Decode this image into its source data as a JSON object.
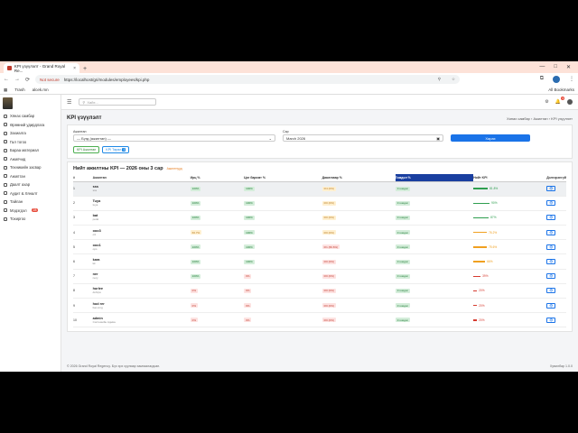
{
  "browser": {
    "tab_title": "KPI үзүүлэлт - Grand Royal Re...",
    "not_secure": "Not secure",
    "url": "https://localhost/gri/modules/employees/kpi.php",
    "bookmarks": [
      "Trash",
      "alcek.mn"
    ],
    "all_bookmarks": "All Bookmarks"
  },
  "sidebar": {
    "items": [
      {
        "label": "Хянах самбар"
      },
      {
        "label": "Өрөөний удирдлага"
      },
      {
        "label": "Захиалга"
      },
      {
        "label": "Гал тогоо"
      },
      {
        "label": "Бараа материал"
      },
      {
        "label": "Ажилчид"
      },
      {
        "label": "Техникийн засвар"
      },
      {
        "label": "Ажилтан"
      },
      {
        "label": "Даалт ахар"
      },
      {
        "label": "Аудит & Хяналт"
      },
      {
        "label": "Тайлан"
      },
      {
        "label": "Мэдэгдэл",
        "badge": "28"
      },
      {
        "label": "Тохиргоо"
      }
    ]
  },
  "topbar": {
    "search_placeholder": "Хайх...",
    "notif_count": "3"
  },
  "page": {
    "title": "KPI үзүүлэлт",
    "breadcrumb": "Хянах самбар › Ажилтан › KPI үзүүлэлт"
  },
  "filters": {
    "employee_label": "Ажилтан",
    "employee_value": "— Бүгд (ажилтан) —",
    "month_label": "Сар",
    "month_value": "March 2026",
    "submit_label": "Харах",
    "chip_summary": "KPI Ажилтан",
    "chip_type": "KPI Төрөл",
    "chip_type_count": "1"
  },
  "table": {
    "title": "Нийт ажилтны KPI — 2026 оны 3 сар",
    "subtitle": "Ажилтнууд",
    "columns": [
      "#",
      "Ажилтан",
      "Ирц %",
      "Цаг баримт %",
      "Даалгавар %",
      "Гомдол %",
      "Нийт KPI",
      "Дэлгэрэнгүй"
    ],
    "rows": [
      {
        "n": "1",
        "name": "sss",
        "login": "sss",
        "attendance": "100%",
        "att_c": "g",
        "hours": "100%",
        "hrs_c": "g",
        "tasks": "0/4 (0%)",
        "tsk_c": "o",
        "complaint": "0 гомдол",
        "kpi": "81.8%",
        "kpi_c": "g",
        "kpi_frac": 0.818
      },
      {
        "n": "2",
        "name": "Tuya",
        "login": "tuya",
        "attendance": "100%",
        "att_c": "g",
        "hours": "100%",
        "hrs_c": "g",
        "tasks": "0/0 (0%)",
        "tsk_c": "o",
        "complaint": "0 гомдол",
        "kpi": "90%",
        "kpi_c": "g",
        "kpi_frac": 0.9
      },
      {
        "n": "3",
        "name": "bat",
        "login": "petal",
        "attendance": "100%",
        "att_c": "g",
        "hours": "100%",
        "hrs_c": "g",
        "tasks": "0/0 (0%)",
        "tsk_c": "o",
        "complaint": "0 гомдол",
        "kpi": "87%",
        "kpi_c": "g",
        "kpi_frac": 0.87
      },
      {
        "n": "4",
        "name": "ooo3",
        "login": "o3",
        "attendance": "66.7%",
        "att_c": "o",
        "hours": "100%",
        "hrs_c": "g",
        "tasks": "0/0 (0%)",
        "tsk_c": "o",
        "complaint": "0 гомдол",
        "kpi": "76.2%",
        "kpi_c": "o",
        "kpi_frac": 0.762
      },
      {
        "n": "5",
        "name": "ooo1",
        "login": "ops",
        "attendance": "100%",
        "att_c": "g",
        "hours": "100%",
        "hrs_c": "g",
        "tasks": "0/1 (66.6%)",
        "tsk_c": "r",
        "complaint": "0 гомдол",
        "kpi": "75.6%",
        "kpi_c": "o",
        "kpi_frac": 0.756
      },
      {
        "n": "6",
        "name": "kara",
        "login": "kk",
        "attendance": "100%",
        "att_c": "g",
        "hours": "100%",
        "hrs_c": "g",
        "tasks": "0/0 (0%)",
        "tsk_c": "r",
        "complaint": "0 гомдол",
        "kpi": "66%",
        "kpi_c": "o",
        "kpi_frac": 0.66
      },
      {
        "n": "7",
        "name": "ner",
        "login": "nery",
        "attendance": "100%",
        "att_c": "g",
        "hours": "0%",
        "hrs_c": "r",
        "tasks": "0/0 (0%)",
        "tsk_c": "r",
        "complaint": "0 гомдол",
        "kpi": "39%",
        "kpi_c": "r",
        "kpi_frac": 0.39
      },
      {
        "n": "8",
        "name": "hurlee",
        "login": "dohrpu",
        "attendance": "0%",
        "att_c": "r",
        "hours": "0%",
        "hrs_c": "r",
        "tasks": "0/0 (0%)",
        "tsk_c": "r",
        "complaint": "0 гомдол",
        "kpi": "20%",
        "kpi_c": "r",
        "kpi_frac": 0.2
      },
      {
        "n": "9",
        "name": "hod rer",
        "login": "bat orng",
        "attendance": "0%",
        "att_c": "r",
        "hours": "0%",
        "hrs_c": "r",
        "tasks": "0/0 (0%)",
        "tsk_c": "r",
        "complaint": "0 гомдол",
        "kpi": "20%",
        "kpi_c": "r",
        "kpi_frac": 0.2
      },
      {
        "n": "10",
        "name": "admin",
        "login": "Системийн Админ",
        "attendance": "0%",
        "att_c": "r",
        "hours": "0%",
        "hrs_c": "r",
        "tasks": "0/0 (0%)",
        "tsk_c": "r",
        "complaint": "0 гомдол",
        "kpi": "20%",
        "kpi_c": "r",
        "kpi_frac": 0.2
      }
    ]
  },
  "footer": {
    "copyright": "© 2026 Grand Royal Regency. Бүх эрх хуулиар хамгаалагдсан.",
    "version": "Хувилбар 1.0.0"
  },
  "colors": {
    "green": "#2e9e4f",
    "orange": "#f0a020",
    "red": "#d63b30",
    "accent": "#1a73e8"
  }
}
